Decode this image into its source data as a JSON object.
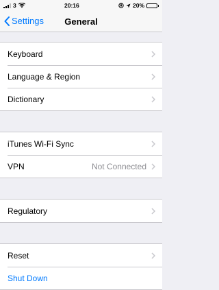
{
  "status": {
    "carrier": "3",
    "time": "20:16",
    "battery_pct": "20%",
    "battery_level": 0.2
  },
  "nav": {
    "back_label": "Settings",
    "title": "General"
  },
  "groups": [
    {
      "rows": [
        {
          "label": "Keyboard",
          "chevron": true
        },
        {
          "label": "Language & Region",
          "chevron": true
        },
        {
          "label": "Dictionary",
          "chevron": true
        }
      ]
    },
    {
      "rows": [
        {
          "label": "iTunes Wi-Fi Sync",
          "chevron": true
        },
        {
          "label": "VPN",
          "detail": "Not Connected",
          "chevron": true
        }
      ]
    },
    {
      "rows": [
        {
          "label": "Regulatory",
          "chevron": true
        }
      ]
    },
    {
      "rows": [
        {
          "label": "Reset",
          "chevron": true
        },
        {
          "label": "Shut Down",
          "link": true
        }
      ]
    }
  ],
  "colors": {
    "accent": "#007aff",
    "background": "#efeff4",
    "separator": "#c8c7cc",
    "chevron": "#c7c7cc",
    "detail_text": "#8e8e93"
  }
}
